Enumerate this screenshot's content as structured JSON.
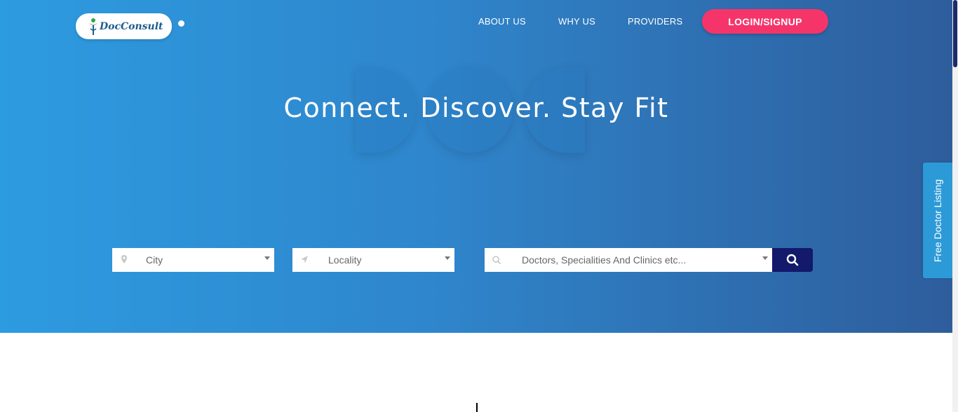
{
  "brand": {
    "name": "DocConsult"
  },
  "nav": {
    "about": "ABOUT US",
    "why": "WHY US",
    "providers": "PROVIDERS",
    "login": "LOGIN/SIGNUP"
  },
  "hero": {
    "headline": "Connect. Discover. Stay Fit"
  },
  "search": {
    "city_placeholder": "City",
    "locality_placeholder": "Locality",
    "query_placeholder": "Doctors, Specialities And Clinics etc...",
    "icons": [
      "map-pin-icon",
      "location-arrow-icon",
      "search-icon"
    ]
  },
  "side_tab": {
    "label": "Free Doctor Listing"
  },
  "colors": {
    "hero_start": "#2d9be0",
    "hero_end": "#2e5d9c",
    "login_button": "#f5356a",
    "search_button": "#13196b",
    "side_tab": "#2d9ad8"
  }
}
